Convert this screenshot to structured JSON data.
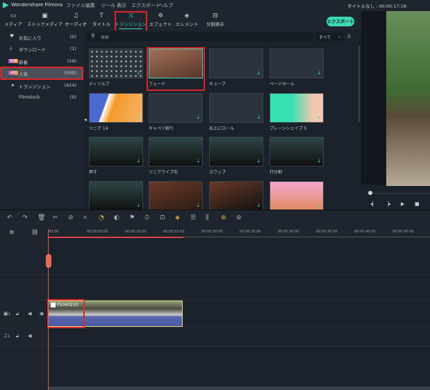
{
  "app": {
    "name": "Wondershare Filmora",
    "doc_title": "タイトルなし : 00:00:17:18"
  },
  "menu": [
    "ファイル",
    "編集",
    "ツール",
    "表示",
    "エクスポート",
    "ヘルプ"
  ],
  "toolbar": [
    {
      "label": "メディア",
      "icon": "folder-icon"
    },
    {
      "label": "ストックメディア",
      "icon": "image-icon"
    },
    {
      "label": "オーディオ",
      "icon": "music-icon"
    },
    {
      "label": "タイトル",
      "icon": "text-icon"
    },
    {
      "label": "トランジション",
      "icon": "transition-icon",
      "active": true
    },
    {
      "label": "エフェクト",
      "icon": "effect-icon"
    },
    {
      "label": "エレメント",
      "icon": "element-icon"
    },
    {
      "label": "分割表示",
      "icon": "split-icon"
    }
  ],
  "export_label": "エクスポート",
  "sidebar": [
    {
      "label": "お気に入り",
      "count": "(0)"
    },
    {
      "label": "ダウンロード",
      "count": "(1)"
    },
    {
      "label": "新着",
      "count": "(29)",
      "badge": "NEW"
    },
    {
      "label": "人気",
      "count": "(500)",
      "badge": "HOT",
      "selected": true
    },
    {
      "label": "トランジション",
      "count": "(424)"
    },
    {
      "label": "Filmstock",
      "count": "(0)"
    }
  ],
  "search": {
    "placeholder": "検索",
    "filter": "すべて"
  },
  "transitions": [
    "ディゾルブ",
    "フェード",
    "キューブ",
    "ページカール",
    "リニア 14",
    "キャベツ割り",
    "右上にロール",
    "プレーンシェイプ 5",
    "押す",
    "リニアワイプ右",
    "スワップ",
    "行分割",
    "",
    "",
    "",
    ""
  ],
  "timeline": {
    "ticks": [
      "00:00",
      "00:00:05:00",
      "00:00:10:00",
      "00:00:15:00",
      "00:00:20:00",
      "00:00:25:00",
      "00:00:30:00",
      "00:00:35:00",
      "00:00:40:00",
      "00:00:45:00"
    ],
    "clip_name": "P1040210",
    "video_track": "1",
    "audio_track": "1"
  },
  "colors": {
    "accent": "#3fd8b5",
    "highlight": "#e3252b",
    "playhead": "#e85a4f"
  }
}
